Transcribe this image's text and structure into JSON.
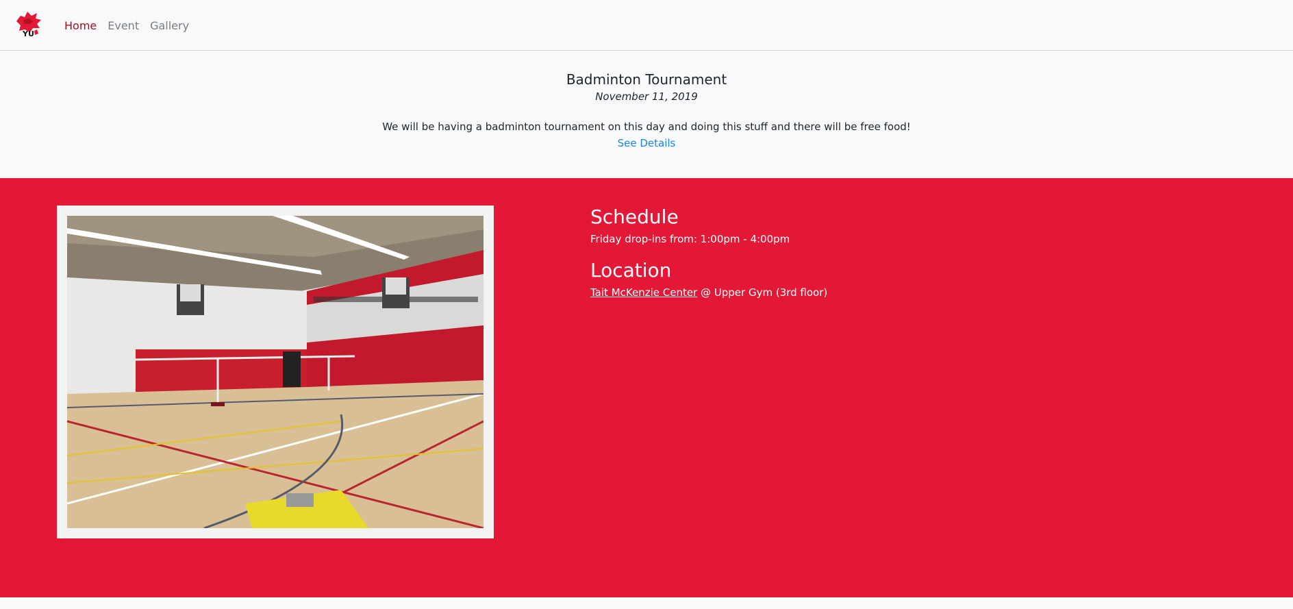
{
  "nav": {
    "logo_text": "YU",
    "items": [
      {
        "label": "Home",
        "active": true
      },
      {
        "label": "Event",
        "active": false
      },
      {
        "label": "Gallery",
        "active": false
      }
    ]
  },
  "event": {
    "title": "Badminton Tournament",
    "date": "November 11, 2019",
    "description": "We will be having a badminton tournament on this day and doing this stuff and there will be free food!",
    "link_label": "See Details"
  },
  "details": {
    "schedule_heading": "Schedule",
    "schedule_text": "Friday drop-ins from: 1:00pm - 4:00pm",
    "location_heading": "Location",
    "location_link": "Tait McKenzie Center",
    "location_suffix": " @ Upper Gym (3rd floor)"
  },
  "colors": {
    "accent_red": "#e31837",
    "nav_active": "#a50e1d",
    "link_blue": "#1a85e3"
  },
  "icons": {
    "logo": "yu-lion-logo-icon"
  }
}
